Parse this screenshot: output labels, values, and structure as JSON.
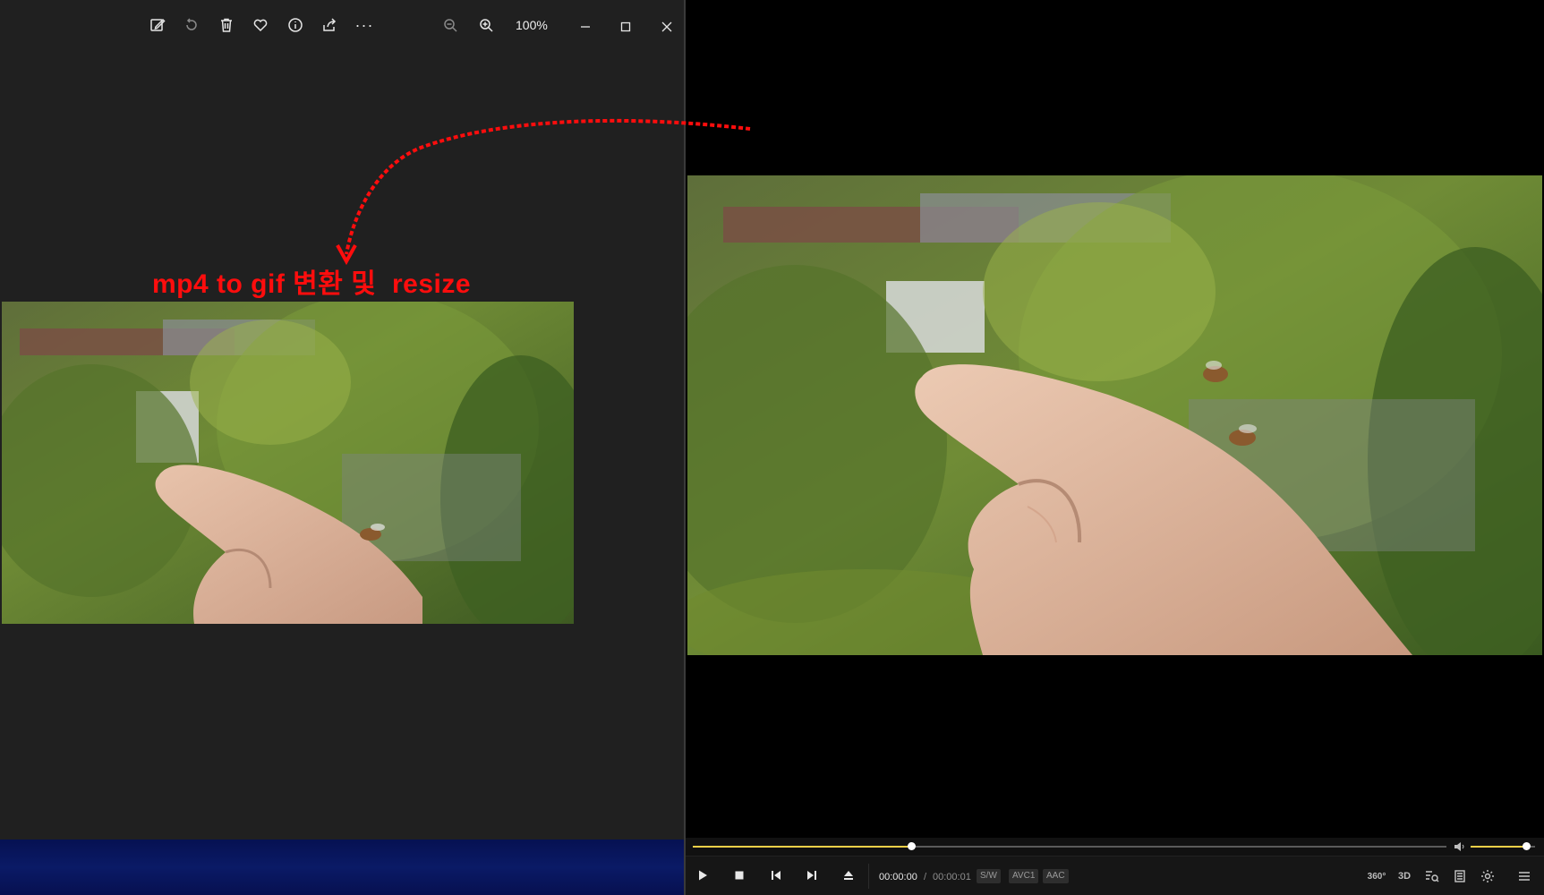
{
  "viewer": {
    "toolbar": {
      "edit_icon": "edit-image-icon",
      "rotate_icon": "rotate-icon",
      "delete_icon": "trash-icon",
      "favorite_icon": "heart-icon",
      "info_icon": "info-icon",
      "share_icon": "share-icon",
      "more_label": "···",
      "zoom_out_icon": "zoom-out-icon",
      "zoom_in_icon": "zoom-in-icon",
      "zoom_level": "100%"
    },
    "annotation": "mp4 to gif 변환 및  resize",
    "annotation_color": "#ff0d0d"
  },
  "player": {
    "seek_progress": 0.29,
    "volume_level": 0.86,
    "time_current": "00:00:00",
    "time_separator": "/",
    "time_duration": "00:00:01",
    "badges": [
      "S/W",
      "AVC1",
      "AAC"
    ],
    "right_labels": {
      "vr": "360°",
      "three_d": "3D"
    },
    "accent_color": "#f2d048"
  }
}
